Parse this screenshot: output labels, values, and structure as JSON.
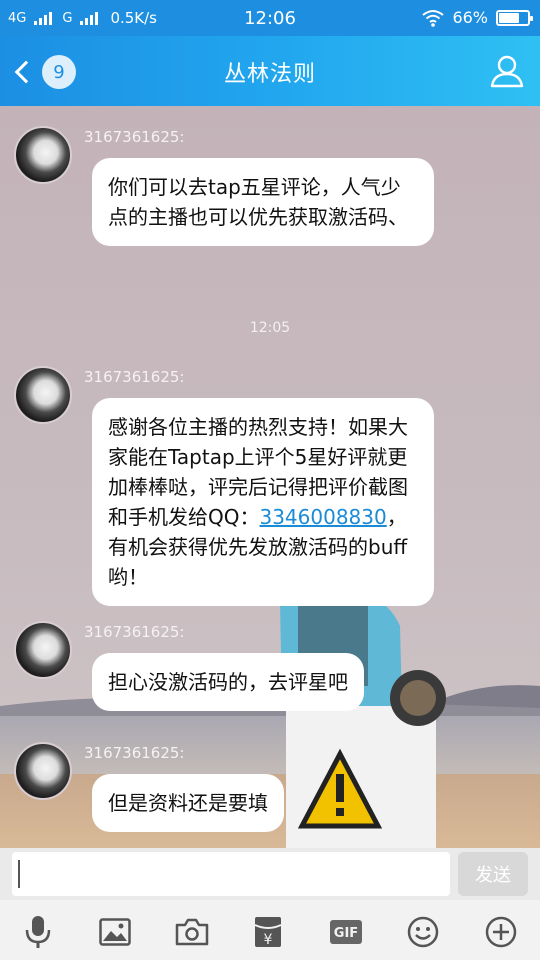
{
  "status_bar": {
    "net1": "4G",
    "net2": "G",
    "speed": "0.5K/s",
    "time": "12:06",
    "battery_label": "66%",
    "battery_level": 0.66
  },
  "title_bar": {
    "unread_count": "9",
    "title": "丛林法则"
  },
  "messages": [
    {
      "name": "3167361625:",
      "text": "你们可以去tap五星评论，人气少点的主播也可以优先获取激活码、"
    },
    {
      "name": "3167361625:",
      "text_before": "感谢各位主播的热烈支持！如果大家能在Taptap上评个5星好评就更加棒棒哒，评完后记得把评价截图和手机发给QQ：",
      "qq": "3346008830",
      "text_after": "，有机会获得优先发放激活码的buff哟！"
    },
    {
      "name": "3167361625:",
      "text": "担心没激活码的，去评星吧"
    },
    {
      "name": "3167361625:",
      "text": "但是资料还是要填"
    }
  ],
  "time_divider": "12:05",
  "input_bar": {
    "value": "",
    "send_label": "发送"
  },
  "toolbar": {
    "icons": [
      "microphone-icon",
      "image-icon",
      "camera-icon",
      "red-packet-icon",
      "gif-icon",
      "emoji-icon",
      "plus-icon"
    ],
    "gif_label": "GIF",
    "red_packet_symbol": "¥"
  },
  "colors": {
    "header_start": "#1c8fe3",
    "header_end": "#2fc0f3",
    "link": "#1a8bd6",
    "chat_bg": "#c5b6bc"
  }
}
